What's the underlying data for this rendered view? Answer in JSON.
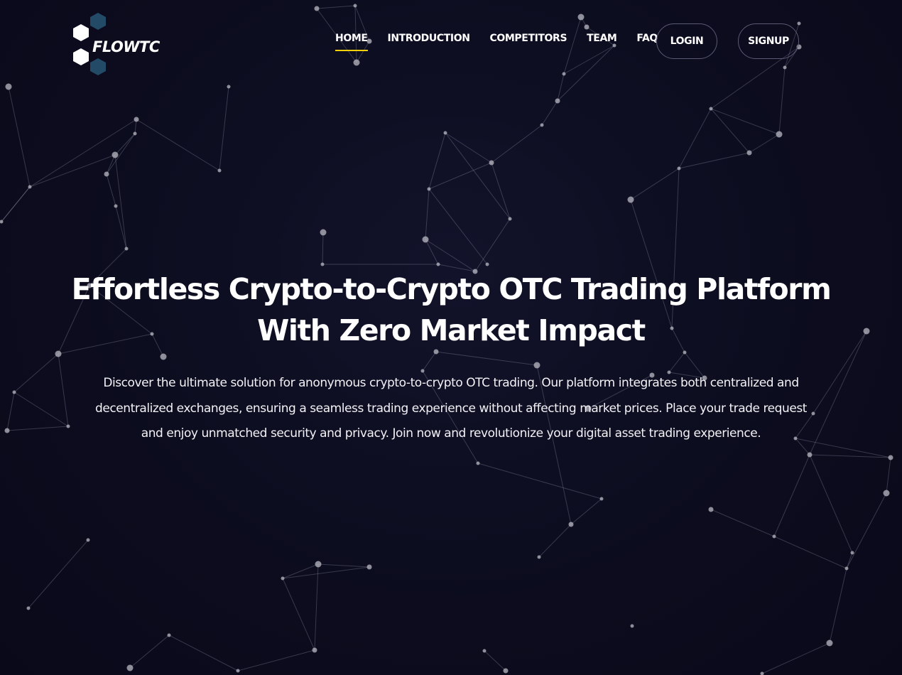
{
  "brand": {
    "name": "FLOWTC",
    "colors": {
      "hex_light": "#ffffff",
      "hex_dark": "#234a66",
      "accent": "#f2d10c",
      "background": "#0d0d20"
    }
  },
  "nav": {
    "items": [
      {
        "label": "HOME",
        "active": true
      },
      {
        "label": "INTRODUCTION",
        "active": false
      },
      {
        "label": "COMPETITORS",
        "active": false
      },
      {
        "label": "TEAM",
        "active": false
      },
      {
        "label": "FAQ",
        "active": false
      }
    ],
    "login_label": "LOGIN",
    "signup_label": "SIGNUP"
  },
  "hero": {
    "title_line1": "Effortless Crypto-to-Crypto OTC Trading Platform",
    "title_line2": "With Zero Market Impact",
    "description_line1": "Discover the ultimate solution for anonymous crypto-to-crypto OTC trading. Our platform integrates both centralized and",
    "description_line2": "decentralized exchanges, ensuring a seamless trading experience without affecting market prices. Place your trade request",
    "description_line3": "and enjoy unmatched security and privacy. Join now and revolutionize your digital asset trading experience."
  },
  "background": {
    "pattern": "particle-network"
  }
}
